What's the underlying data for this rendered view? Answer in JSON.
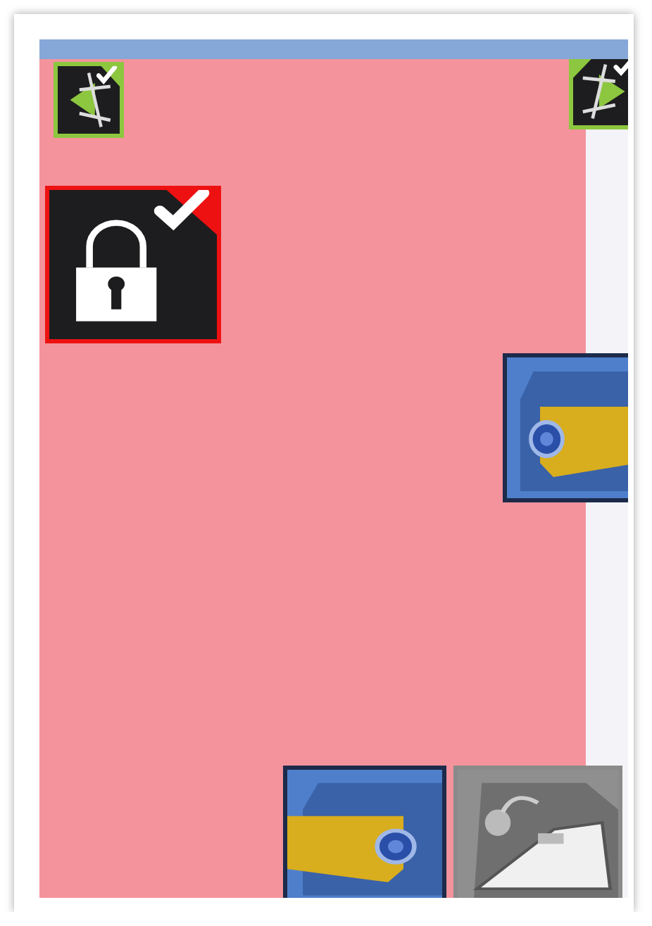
{
  "zone": {
    "alarm": true
  },
  "devices": [
    {
      "kind": "sensor",
      "alarm": false,
      "offline": false,
      "checked": true,
      "mirrored": false
    },
    {
      "kind": "sensor",
      "alarm": false,
      "offline": false,
      "checked": true,
      "mirrored": true
    },
    {
      "kind": "lock",
      "alarm": true,
      "offline": false,
      "checked": true,
      "mirrored": false
    },
    {
      "kind": "camera",
      "alarm": false,
      "offline": false,
      "checked": false,
      "mirrored": false
    },
    {
      "kind": "camera",
      "alarm": false,
      "offline": false,
      "checked": false,
      "mirrored": true
    },
    {
      "kind": "intercom",
      "alarm": false,
      "offline": true,
      "checked": false,
      "mirrored": false
    }
  ]
}
